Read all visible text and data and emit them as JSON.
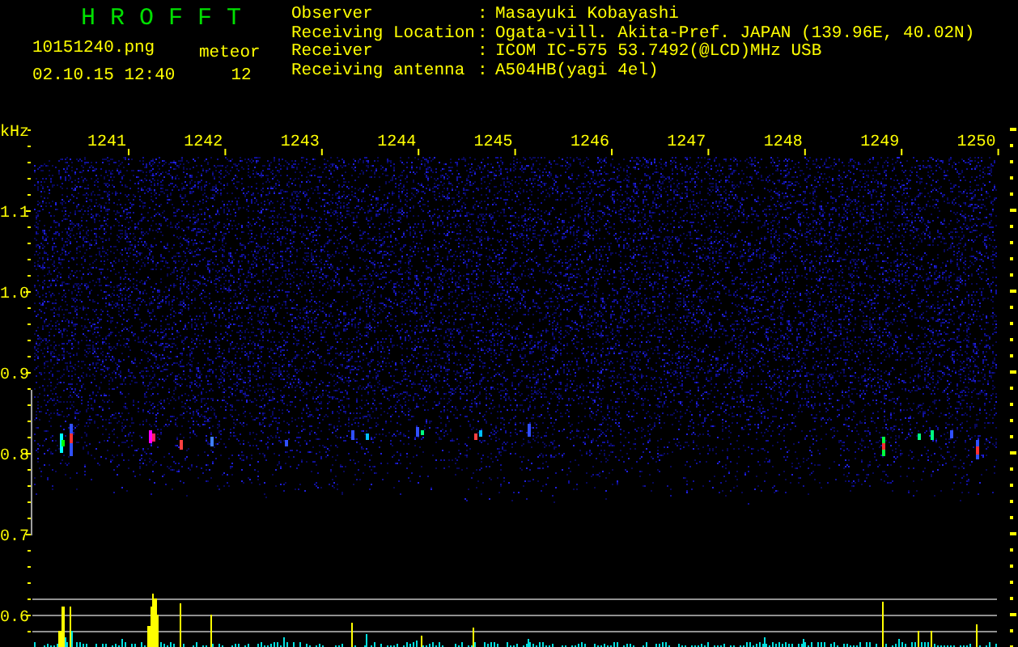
{
  "header": {
    "title": "H R O F F T",
    "file_name": "10151240.png",
    "meteor_label": "meteor",
    "timestamp": "02.10.15 12:40",
    "meteor_count": "12"
  },
  "station_info": [
    {
      "label": "Observer",
      "separator": ":",
      "value": "Masayuki Kobayashi"
    },
    {
      "label": "Receiving Location",
      "separator": ":",
      "value": "Ogata-vill. Akita-Pref. JAPAN (139.96E, 40.02N)"
    },
    {
      "label": "Receiver",
      "separator": ":",
      "value": "ICOM IC-575 53.7492(@LCD)MHz USB"
    },
    {
      "label": "Receiving antenna",
      "separator": ":",
      "value": "A504HB(yagi 4el)"
    }
  ],
  "spectrogram": {
    "frequency_unit": "kHz",
    "frequency_labels": [
      "1.1",
      "1.0",
      "0.9",
      "0.8",
      "0.7",
      "0.6"
    ],
    "time_labels": [
      "1241",
      "1242",
      "1243",
      "1244",
      "1245",
      "1246",
      "1247",
      "1248",
      "1249",
      "1250"
    ]
  }
}
